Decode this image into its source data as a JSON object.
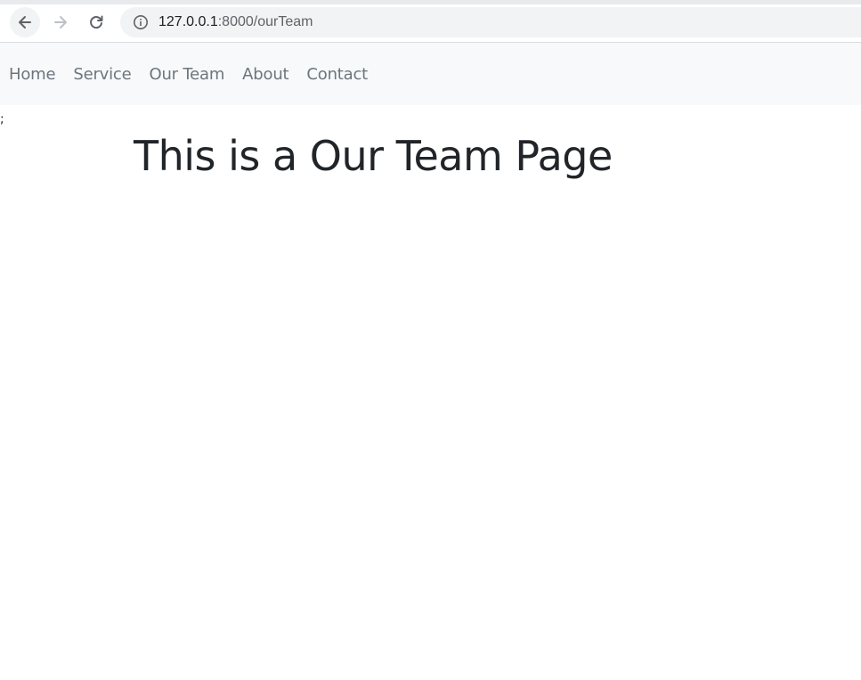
{
  "browser": {
    "url_host": "127.0.0.1",
    "url_rest": ":8000/ourTeam",
    "icons": {
      "back": "arrow-left-icon",
      "forward": "arrow-right-icon",
      "reload": "reload-icon",
      "site_info": "info-icon"
    }
  },
  "navbar": {
    "items": [
      {
        "label": "Home"
      },
      {
        "label": "Service"
      },
      {
        "label": "Our Team"
      },
      {
        "label": "About"
      },
      {
        "label": "Contact"
      }
    ]
  },
  "page": {
    "stray_text": ";",
    "heading": "This is a Our Team Page"
  },
  "colors": {
    "navbar_bg": "#f8f9fa",
    "nav_link": "#6c757d",
    "heading": "#212529"
  }
}
